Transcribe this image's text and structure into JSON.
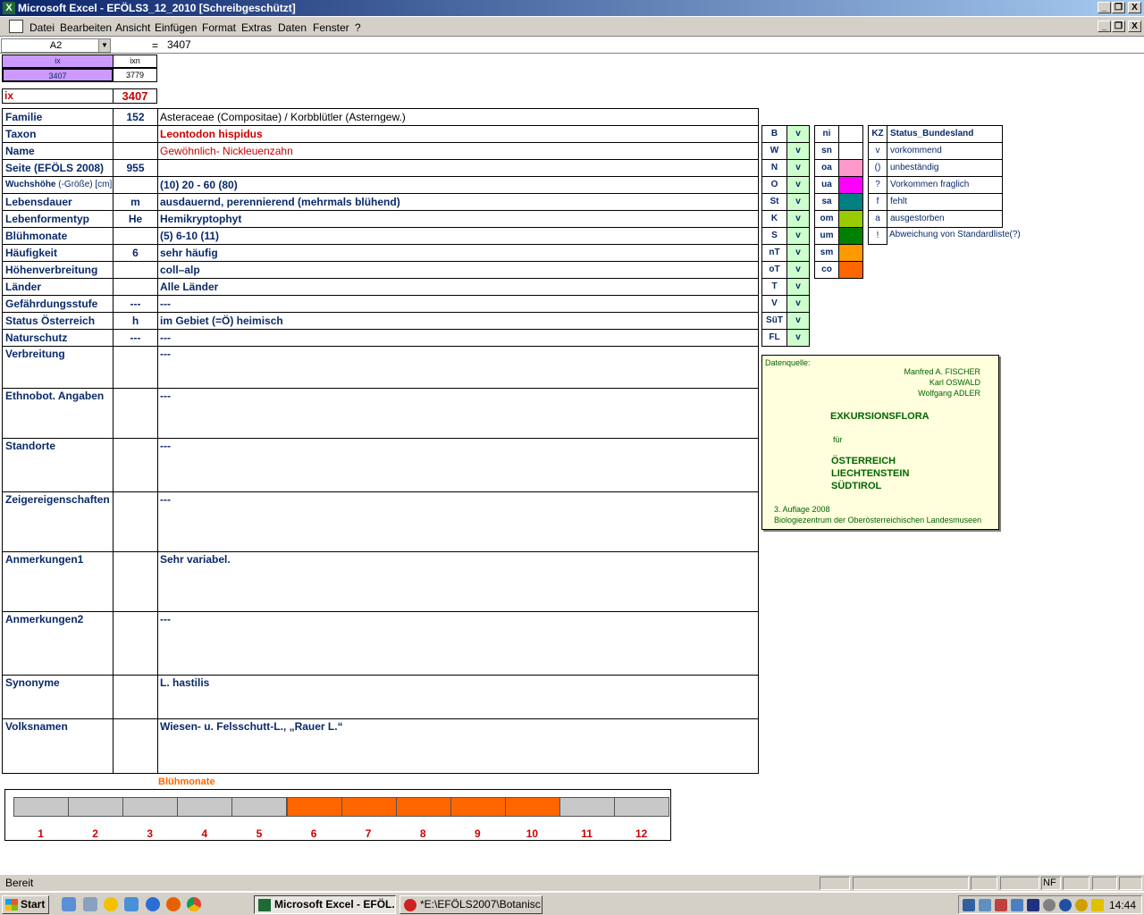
{
  "window": {
    "title": "Microsoft Excel - EFÖLS3_12_2010  [Schreibgeschützt]",
    "controls": [
      "_",
      "❐",
      "X"
    ]
  },
  "menu": [
    "Datei",
    "Bearbeiten",
    "Ansicht",
    "Einfügen",
    "Format",
    "Extras",
    "Daten",
    "Fenster",
    "?"
  ],
  "formula_bar": {
    "name_box": "A2",
    "eq": "=",
    "value": "3407"
  },
  "index_header": {
    "ix_label": "ix",
    "ixn_label": "ixn",
    "ix_value": "3407",
    "ixn_value": "3779"
  },
  "ix_row": {
    "label": "ix",
    "value": "3407"
  },
  "fields": [
    {
      "label": "Familie",
      "code": "152",
      "text": "Asteraceae (Compositae)  /  Korbblütler (Asterngew.)"
    },
    {
      "label": "Taxon",
      "code": "",
      "text": "Leontodon hispidus"
    },
    {
      "label": "Name",
      "code": "",
      "text": "Gewöhnlich- Nickleuenzahn"
    },
    {
      "label": "Seite (EFÖLS 2008)",
      "code": "955",
      "text": ""
    },
    {
      "label": "Wuchshöhe",
      "label_suffix": "(-Größe) [cm]",
      "code": "",
      "text": "(10) 20 - 60 (80)"
    },
    {
      "label": "Lebensdauer",
      "code": "m",
      "text": "ausdauernd, perennierend (mehrmals blühend)"
    },
    {
      "label": "Lebenformentyp",
      "code": "He",
      "text": "Hemikryptophyt"
    },
    {
      "label": "Blühmonate",
      "code": "",
      "text": "(5) 6-10 (11)"
    },
    {
      "label": "Häufigkeit",
      "code": "6",
      "text": "sehr häufig"
    },
    {
      "label": "Höhenverbreitung",
      "code": "",
      "text": "coll–alp"
    },
    {
      "label": "Länder",
      "code": "",
      "text": "Alle Länder"
    },
    {
      "label": "Gefährdungsstufe",
      "code": "---",
      "text": "---"
    },
    {
      "label": "Status Österreich",
      "code": "h",
      "text": "im Gebiet (=Ö) heimisch"
    },
    {
      "label": "Naturschutz",
      "code": "---",
      "text": "---"
    },
    {
      "label": "Verbreitung",
      "code": "",
      "text": "---"
    },
    {
      "label": "Ethnobot. Angaben",
      "code": "",
      "text": "---"
    },
    {
      "label": "Standorte",
      "code": "",
      "text": "---"
    },
    {
      "label": "Zeigereigenschaften",
      "code": "",
      "text": "---"
    },
    {
      "label": "Anmerkungen1",
      "code": "",
      "text": "Sehr variabel."
    },
    {
      "label": "Anmerkungen2",
      "code": "",
      "text": "---"
    },
    {
      "label": "Synonyme",
      "code": "",
      "text": "L. hastilis"
    },
    {
      "label": "Volksnamen",
      "code": "",
      "text": "Wiesen- u. Felsschutt-L., „Rauer L.“"
    }
  ],
  "state_table": [
    {
      "k": "B",
      "v": "v"
    },
    {
      "k": "W",
      "v": "v"
    },
    {
      "k": "N",
      "v": "v"
    },
    {
      "k": "O",
      "v": "v"
    },
    {
      "k": "St",
      "v": "v"
    },
    {
      "k": "K",
      "v": "v"
    },
    {
      "k": "S",
      "v": "v"
    },
    {
      "k": "nT",
      "v": "v"
    },
    {
      "k": "oT",
      "v": "v"
    },
    {
      "k": "T",
      "v": "v"
    },
    {
      "k": "V",
      "v": "v"
    },
    {
      "k": "SüT",
      "v": "v"
    },
    {
      "k": "FL",
      "v": "v"
    }
  ],
  "zone_table": [
    {
      "k": "ni",
      "color": ""
    },
    {
      "k": "sn",
      "color": ""
    },
    {
      "k": "oa",
      "color": "#ff99cc"
    },
    {
      "k": "ua",
      "color": "#ff00ff"
    },
    {
      "k": "sa",
      "color": "#008080"
    },
    {
      "k": "om",
      "color": "#99cc00"
    },
    {
      "k": "um",
      "color": "#008000"
    },
    {
      "k": "sm",
      "color": "#ff9900"
    },
    {
      "k": "co",
      "color": "#ff6600"
    }
  ],
  "status_legend": {
    "header_kz": "KZ",
    "header": "Status_Bundesland",
    "rows": [
      {
        "k": "v",
        "t": "vorkommend"
      },
      {
        "k": "()",
        "t": "unbeständig"
      },
      {
        "k": "?",
        "t": "Vorkommen fraglich"
      },
      {
        "k": "f",
        "t": "fehlt"
      },
      {
        "k": "a",
        "t": "ausgestorben"
      },
      {
        "k": "!",
        "t": "Abweichung von Standardliste(?)"
      }
    ]
  },
  "source": {
    "label": "Datenquelle:",
    "authors": [
      "Manfred A. FISCHER",
      "Karl OSWALD",
      "Wolfgang ADLER"
    ],
    "title": "EXKURSIONSFLORA",
    "fuer": "für",
    "countries": [
      "ÖSTERREICH",
      "LIECHTENSTEIN",
      "SÜDTIROL"
    ],
    "edition": "3. Auflage 2008",
    "publisher": "Biologiezentrum der Oberösterreichischen Landesmuseen"
  },
  "bloom_chart": {
    "title": "Blühmonate",
    "months": [
      "1",
      "2",
      "3",
      "4",
      "5",
      "6",
      "7",
      "8",
      "9",
      "10",
      "11",
      "12"
    ],
    "flowering": [
      false,
      false,
      false,
      false,
      false,
      true,
      true,
      true,
      true,
      true,
      false,
      false
    ],
    "on_color": "#ff6600",
    "off_color": "#c8c8c8"
  },
  "statusbar": {
    "text": "Bereit",
    "nf": "NF"
  },
  "taskbar": {
    "start": "Start",
    "buttons": [
      "Microsoft Excel - EFÖL...",
      "*E:\\EFÖLS2007\\Botanisc..."
    ],
    "clock": "14:44"
  }
}
